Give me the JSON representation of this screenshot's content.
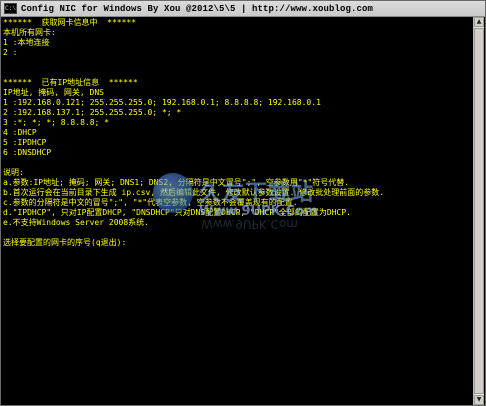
{
  "window": {
    "icon_text": "C:\\",
    "title": "Config NIC  for Windows By Xou @2012\\5\\5 | http://www.xoublog.com"
  },
  "console": {
    "lines": [
      {
        "text": "******  获取网卡信息中  ******",
        "color": "yellow"
      },
      {
        "text": "本机所有网卡:",
        "color": "yellow"
      },
      {
        "text": "1 :本地连接",
        "color": "yellow"
      },
      {
        "text": "2 :",
        "color": "yellow"
      },
      {
        "text": "",
        "color": "yellow"
      },
      {
        "text": "",
        "color": "yellow"
      },
      {
        "text": "******  已有IP地址信息  ******",
        "color": "yellow"
      },
      {
        "text": "IP地址, 掩码, 网关, DNS",
        "color": "yellow"
      },
      {
        "text": "1 :192.168.0.121; 255.255.255.0; 192.168.0.1; 8.8.8.8; 192.168.0.1",
        "color": "yellow"
      },
      {
        "text": "2 :192.168.137.1; 255.255.255.0; *; *",
        "color": "yellow"
      },
      {
        "text": "3 :*; *; *; 8.8.8.8; *",
        "color": "yellow"
      },
      {
        "text": "4 :DHCP",
        "color": "yellow"
      },
      {
        "text": "5 :IPDHCP",
        "color": "yellow"
      },
      {
        "text": "6 :DNSDHCP",
        "color": "yellow"
      },
      {
        "text": "",
        "color": "yellow"
      },
      {
        "text": "说明:",
        "color": "yellow"
      },
      {
        "text": "a.参数:IP地址; 掩码; 网关; DNS1; DNS2, 分隔符是中文冒号\";\", 空参数用\"*\"符号代替.",
        "color": "yellow"
      },
      {
        "text": "b.首次运行会在当前目录下生成 ip.csv, 然后编辑此文件, 修改默认参数设置. 修改批处理前面的参数.",
        "color": "yellow"
      },
      {
        "text": "c.参数的分隔符是中文的冒号\";\", \"*\"代表空参数, 空参数不会覆盖现有的配置.",
        "color": "yellow"
      },
      {
        "text": "d.\"IPDHCP\", 只对IP配置DHCP, \"DNSDHCP\"只对DNS配置DHCP, \"DHCP\"全部的配置为DHCP.",
        "color": "yellow"
      },
      {
        "text": "e.不支持Windows Server 2008系统.",
        "color": "yellow"
      },
      {
        "text": "",
        "color": "yellow"
      },
      {
        "text": "选择要配置的网卡的序号(q退出):",
        "color": "yellow"
      }
    ]
  },
  "watermark": {
    "title": "久友下载站",
    "url": "Www.9UPK.Com"
  },
  "colors": {
    "console_bg": "#000000",
    "console_text": "#ffff00",
    "titlebar_bg": "#d4d4d4"
  }
}
